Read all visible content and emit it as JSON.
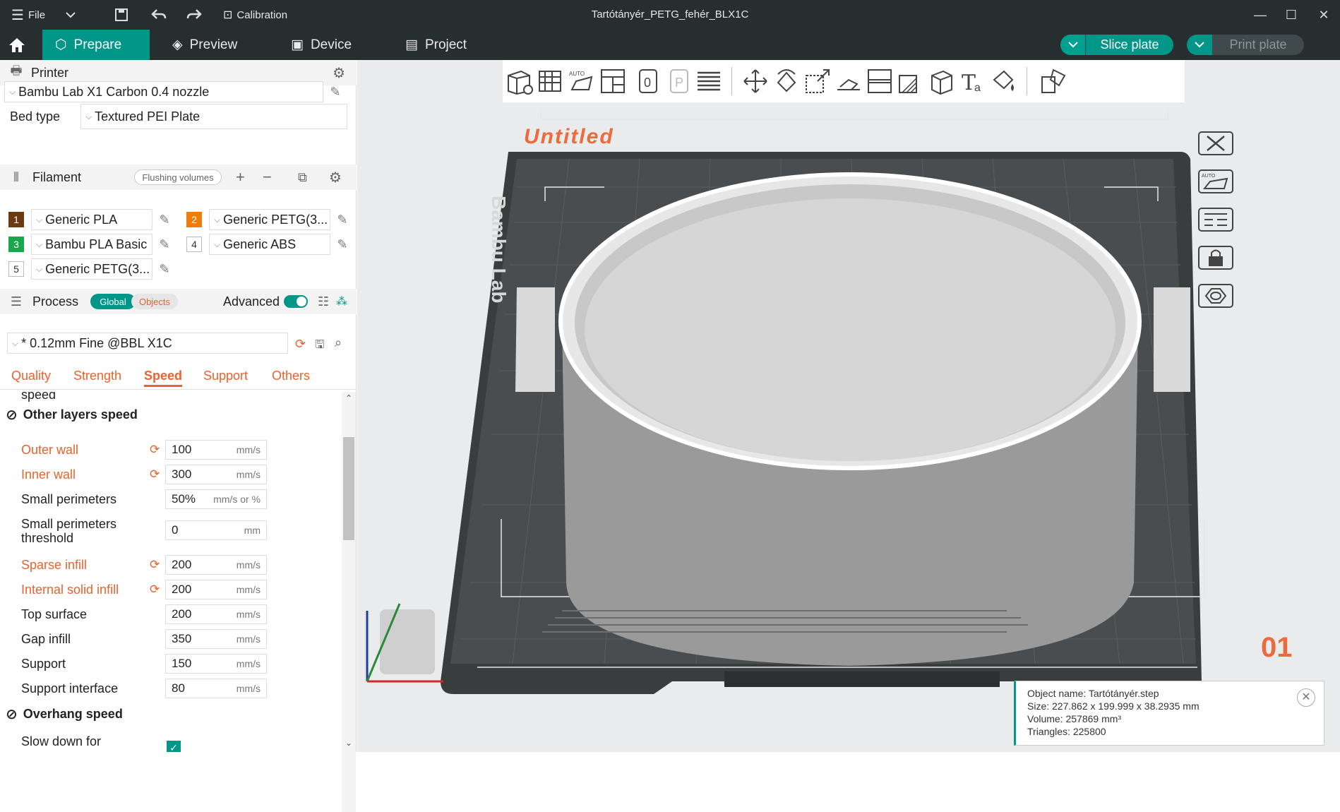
{
  "window": {
    "title": "Tartótányér_PETG_fehér_BLX1C",
    "file_menu": "File",
    "calibration": "Calibration"
  },
  "nav": {
    "tabs": [
      {
        "label": "Prepare",
        "active": true
      },
      {
        "label": "Preview",
        "active": false
      },
      {
        "label": "Device",
        "active": false
      },
      {
        "label": "Project",
        "active": false
      }
    ],
    "slice_button": "Slice plate",
    "print_button": "Print plate"
  },
  "printer": {
    "section_title": "Printer",
    "selected": "Bambu Lab X1 Carbon 0.4 nozzle",
    "bed_type_label": "Bed type",
    "bed_type": "Textured PEI Plate"
  },
  "filament": {
    "section_title": "Filament",
    "flushing_label": "Flushing volumes",
    "slots": [
      {
        "num": "1",
        "name": "Generic PLA",
        "color": "#6b3a12"
      },
      {
        "num": "2",
        "name": "Generic PETG(3...",
        "color": "#f07d0b"
      },
      {
        "num": "3",
        "name": "Bambu PLA Basic",
        "color": "#1aa64a"
      },
      {
        "num": "4",
        "name": "Generic ABS",
        "color": "#ffffff"
      },
      {
        "num": "5",
        "name": "Generic PETG(3...",
        "color": "#ffffff"
      }
    ]
  },
  "process": {
    "section_title": "Process",
    "global_label": "Global",
    "objects_label": "Objects",
    "advanced_label": "Advanced",
    "advanced_on": true,
    "preset": "* 0.12mm Fine @BBL X1C",
    "tabs": [
      "Quality",
      "Strength",
      "Speed",
      "Support",
      "Others"
    ],
    "active_tab": "Speed",
    "partial_label": "speed",
    "group_other": "Other layers speed",
    "rows": [
      {
        "label": "Outer wall",
        "value": "100",
        "unit": "mm/s",
        "modified": true
      },
      {
        "label": "Inner wall",
        "value": "300",
        "unit": "mm/s",
        "modified": true
      },
      {
        "label": "Small perimeters",
        "value": "50%",
        "unit": "mm/s or %",
        "modified": false
      },
      {
        "label": "Small perimeters threshold",
        "value": "0",
        "unit": "mm",
        "modified": false
      },
      {
        "label": "Sparse infill",
        "value": "200",
        "unit": "mm/s",
        "modified": true
      },
      {
        "label": "Internal solid infill",
        "value": "200",
        "unit": "mm/s",
        "modified": true
      },
      {
        "label": "Top surface",
        "value": "200",
        "unit": "mm/s",
        "modified": false
      },
      {
        "label": "Gap infill",
        "value": "350",
        "unit": "mm/s",
        "modified": false
      },
      {
        "label": "Support",
        "value": "150",
        "unit": "mm/s",
        "modified": false
      },
      {
        "label": "Support interface",
        "value": "80",
        "unit": "mm/s",
        "modified": false
      }
    ],
    "group_overhang": "Overhang speed",
    "slow_down_label": "Slow down for",
    "slow_down_checked": true
  },
  "viewport": {
    "plate_name": "Untitled",
    "plate_number": "01",
    "brand_text": "Bambu Lab"
  },
  "object_info": {
    "name": "Object name: Tartótányér.step",
    "size": "Size: 227.862 x 199.999 x 38.2935 mm",
    "volume": "Volume: 257869 mm³",
    "triangles": "Triangles: 225800"
  },
  "colors": {
    "accent": "#009688",
    "modified": "#e8632e",
    "bar_bg": "#262e30"
  }
}
